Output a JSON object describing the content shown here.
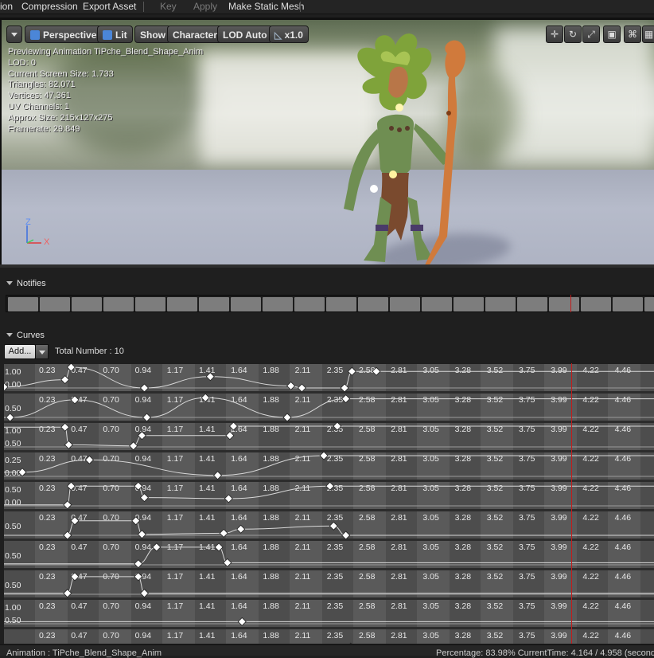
{
  "menu": {
    "items": [
      "ion",
      "Compression",
      "Export Asset",
      "Key",
      "Apply",
      "Make Static Mesh"
    ]
  },
  "viewport": {
    "perspective_label": "Perspective",
    "lit_label": "Lit",
    "show_label": "Show",
    "character_label": "Character",
    "lod_label": "LOD Auto",
    "speed_label": "x1.0",
    "stats": [
      "Previewing Animation TiPche_Blend_Shape_Anim",
      "LOD: 0",
      "Current Screen Size: 1.733",
      "Triangles: 82,071",
      "Vertices: 47,361",
      "UV Channels: 1",
      "Approx Size: 215x127x275",
      "Framerate: 29.849"
    ],
    "axis_z": "Z",
    "axis_x": "X"
  },
  "notifies": {
    "title": "Notifies"
  },
  "curves": {
    "title": "Curves",
    "add_label": "Add...",
    "total_label": "Total Number : 10",
    "time_ticks": [
      "0.23",
      "0.47",
      "0.70",
      "0.94",
      "1.17",
      "1.41",
      "1.64",
      "1.88",
      "2.11",
      "2.35",
      "2.58",
      "2.81",
      "3.05",
      "3.28",
      "3.52",
      "3.75",
      "3.99",
      "4.22",
      "4.46"
    ],
    "rows": [
      {
        "y_labels": [
          "1.00",
          "0.00"
        ],
        "keys": [
          [
            0,
            0.05
          ],
          [
            0.5,
            0.4
          ],
          [
            0.55,
            1
          ],
          [
            1.15,
            0
          ],
          [
            1.69,
            0.55
          ],
          [
            2.35,
            0.1
          ],
          [
            2.44,
            0
          ],
          [
            2.79,
            0
          ],
          [
            2.85,
            0.8
          ],
          [
            3.05,
            0.8
          ]
        ]
      },
      {
        "y_labels": [
          "0.50"
        ],
        "keys": [
          [
            0.05,
            0
          ],
          [
            0.58,
            0.85
          ],
          [
            1.17,
            0
          ],
          [
            1.65,
            0.95
          ],
          [
            2.32,
            0
          ],
          [
            2.8,
            0.9
          ]
        ]
      },
      {
        "y_labels": [
          "1.00",
          "0.50"
        ],
        "keys": [
          [
            0.5,
            0.95
          ],
          [
            0.53,
            0.1
          ],
          [
            1.06,
            0.05
          ],
          [
            1.13,
            0.55
          ],
          [
            1.85,
            0.55
          ],
          [
            1.88,
            1
          ],
          [
            2.73,
            1
          ]
        ]
      },
      {
        "y_labels": [
          "0.25",
          "0.00"
        ],
        "keys": [
          [
            0.15,
            0.2
          ],
          [
            0.7,
            0.8
          ],
          [
            1.75,
            0.05
          ],
          [
            2.62,
            1
          ]
        ]
      },
      {
        "y_labels": [
          "0.50",
          "0.00"
        ],
        "keys": [
          [
            0.52,
            0.05
          ],
          [
            0.55,
            0.95
          ],
          [
            1.1,
            0.95
          ],
          [
            1.15,
            0.4
          ],
          [
            1.84,
            0.35
          ],
          [
            2.67,
            0.95
          ]
        ]
      },
      {
        "y_labels": [
          "0.50"
        ],
        "keys": [
          [
            0.52,
            0
          ],
          [
            0.58,
            0.7
          ],
          [
            1.08,
            0.7
          ],
          [
            1.13,
            0.05
          ],
          [
            1.8,
            0.1
          ],
          [
            1.94,
            0.3
          ],
          [
            2.7,
            0.45
          ],
          [
            2.8,
            0
          ]
        ]
      },
      {
        "y_labels": [
          "0.50"
        ],
        "keys": [
          [
            1.1,
            0.05
          ],
          [
            1.25,
            0.85
          ],
          [
            1.76,
            0.85
          ],
          [
            1.83,
            0.1
          ]
        ]
      },
      {
        "y_labels": [
          "0.50"
        ],
        "keys": [
          [
            0.52,
            0.05
          ],
          [
            0.58,
            0.85
          ],
          [
            1.1,
            0.85
          ],
          [
            1.15,
            0.05
          ]
        ]
      },
      {
        "y_labels": [
          "1.00",
          "0.50"
        ],
        "keys": [
          [
            1.95,
            0.1
          ]
        ]
      },
      {
        "y_labels": [],
        "keys": [
          [
            0.28,
            0.2
          ],
          [
            2.84,
            0.3
          ]
        ]
      }
    ]
  },
  "status": {
    "left": "Animation : TiPche_Blend_Shape_Anim",
    "right": "Percentage: 83.98%  CurrentTime: 4.164 / 4.958 (second"
  }
}
